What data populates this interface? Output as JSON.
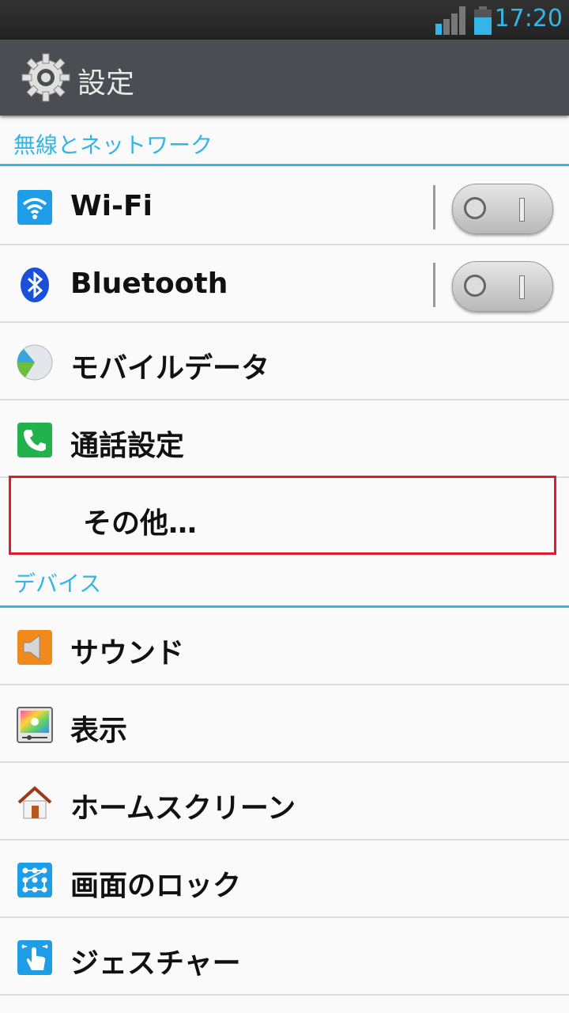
{
  "status_bar": {
    "time": "17:20",
    "accent": "#33b5e5"
  },
  "action_bar": {
    "title": "設定",
    "icon": "gear-icon"
  },
  "sections": [
    {
      "header": "無線とネットワーク"
    },
    {
      "header": "デバイス"
    }
  ],
  "wireless_items": [
    {
      "label": "Wi-Fi",
      "icon": "wifi-icon",
      "toggle": "off"
    },
    {
      "label": "Bluetooth",
      "icon": "bluetooth-icon",
      "toggle": "off"
    },
    {
      "label": "モバイルデータ",
      "icon": "mobile-data-icon"
    },
    {
      "label": "通話設定",
      "icon": "phone-icon"
    },
    {
      "label": "その他…",
      "highlighted": true
    }
  ],
  "device_items": [
    {
      "label": "サウンド",
      "icon": "speaker-icon"
    },
    {
      "label": "表示",
      "icon": "display-icon"
    },
    {
      "label": "ホームスクリーン",
      "icon": "home-icon"
    },
    {
      "label": "画面のロック",
      "icon": "lock-pattern-icon"
    },
    {
      "label": "ジェスチャー",
      "icon": "gesture-hand-icon"
    }
  ],
  "colors": {
    "accent": "#33b5e5",
    "highlight_border": "#e01c2c",
    "action_bar": "#4a4d51"
  }
}
